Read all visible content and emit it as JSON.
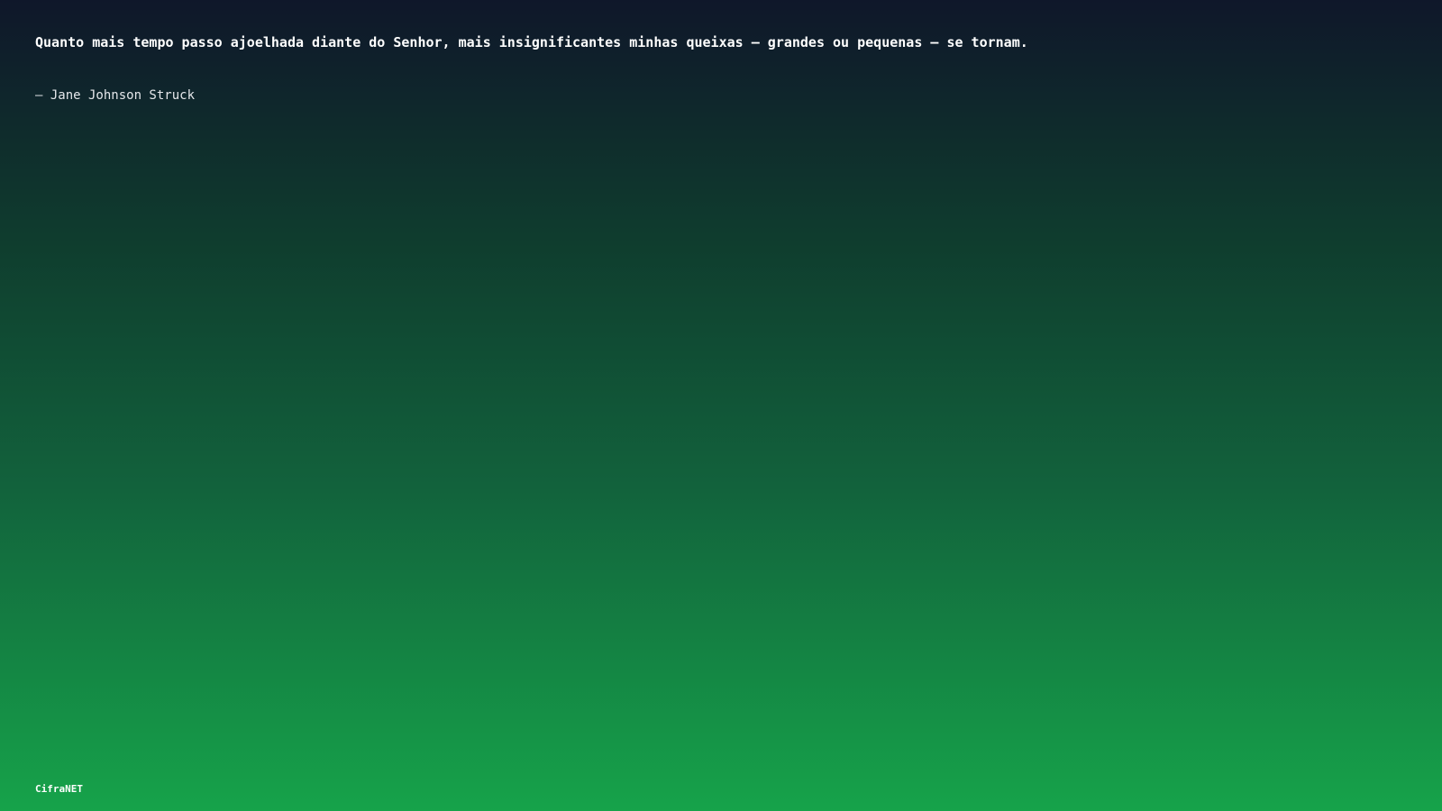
{
  "quote": {
    "text": "Quanto mais tempo passo ajoelhada diante do Senhor, mais insignificantes minhas queixas – grandes ou pequenas – se tornam.",
    "author": "– Jane Johnson Struck"
  },
  "footer": {
    "brand": "CifraNET"
  },
  "colors": {
    "gradient_top": "#0f172a",
    "gradient_bottom": "#16a34a",
    "text": "#ffffff"
  }
}
